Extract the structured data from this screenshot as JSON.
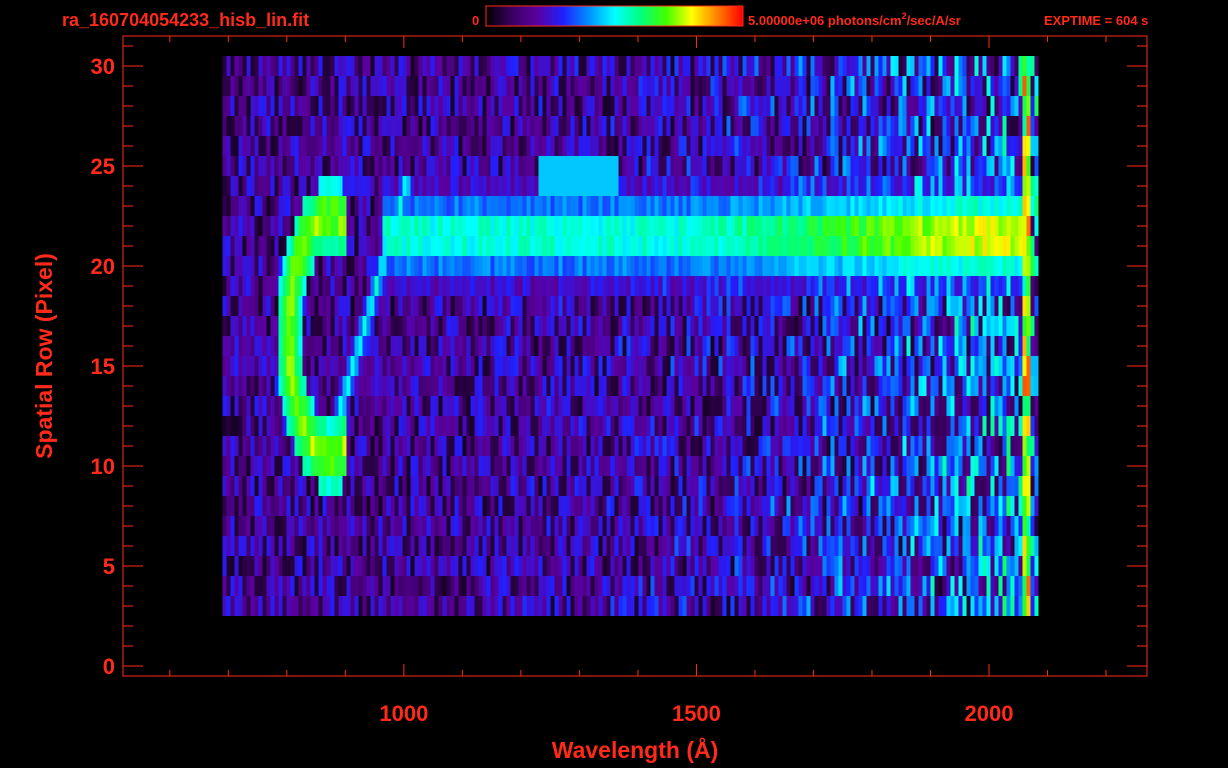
{
  "header": {
    "filename": "ra_160704054233_hisb_lin.fit",
    "colorbar_min": "0",
    "colorbar_max_value": "5.00000e+06",
    "colorbar_unit_pre": "photons/cm",
    "colorbar_unit_sup": "2",
    "colorbar_unit_post": "/sec/A/sr",
    "exptime": "EXPTIME = 604 s"
  },
  "colors": {
    "axis": "#ff2a1a",
    "background": "#000000",
    "colormap": [
      "#000000",
      "#3a0060",
      "#5a00a0",
      "#2020ff",
      "#0090ff",
      "#00ffff",
      "#00ff80",
      "#40ff00",
      "#ffff00",
      "#ff8000",
      "#ff0000"
    ]
  },
  "chart_data": {
    "type": "heatmap",
    "xlabel": "Wavelength (Å)",
    "ylabel": "Spatial Row (Pixel)",
    "xlim": [
      520,
      2270
    ],
    "ylim": [
      -0.5,
      31.5
    ],
    "xticks": [
      1000,
      1500,
      2000
    ],
    "xtick_labels": [
      "1000",
      "1500",
      "2000"
    ],
    "yticks": [
      0,
      5,
      10,
      15,
      20,
      25,
      30
    ],
    "ytick_labels": [
      "0",
      "5",
      "10",
      "15",
      "20",
      "25",
      "30"
    ],
    "data_extent": {
      "x": [
        690,
        2070
      ],
      "y": [
        3,
        30
      ]
    },
    "colorbar": {
      "min": 0,
      "max": 5000000,
      "unit": "photons/cm^2/sec/A/sr"
    },
    "features": [
      {
        "name": "ring",
        "center_x": 870,
        "center_y": 16.5,
        "radius_x": 70,
        "radius_y": 6,
        "intensity": 0.72
      },
      {
        "name": "diagonal-arc",
        "from_x": 860,
        "from_y": 10,
        "to_x": 1000,
        "to_y": 24,
        "intensity": 0.45
      },
      {
        "name": "upper-band",
        "x_start": 960,
        "x_end": 2060,
        "y_min": 19,
        "y_max": 24,
        "peak_x": 1950,
        "peak_intensity": 0.75
      },
      {
        "name": "band-tail",
        "x_start": 1230,
        "x_end": 1360,
        "y": 24.5,
        "intensity": 0.45
      },
      {
        "name": "red-edge",
        "x": 2060,
        "y_min": 1,
        "y_max": 30,
        "intensity": 0.95
      }
    ]
  }
}
